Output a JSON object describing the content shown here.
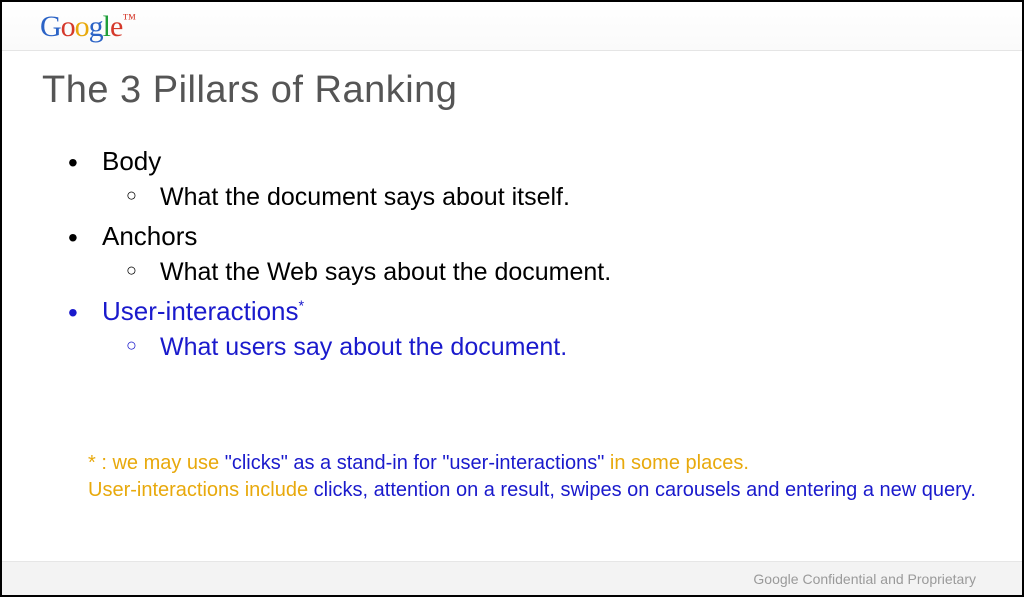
{
  "logo": {
    "g1": "G",
    "o1": "o",
    "o2": "o",
    "g2": "g",
    "l": "l",
    "e": "e",
    "tm": "™"
  },
  "title": "The 3 Pillars of Ranking",
  "pillars": [
    {
      "name": "Body",
      "desc": "What the document says about itself.",
      "highlighted": false
    },
    {
      "name": "Anchors",
      "desc": "What the Web says about the document.",
      "highlighted": false
    },
    {
      "name": "User-interactions",
      "desc": "What users say about the document.",
      "highlighted": true,
      "sup": "*"
    }
  ],
  "footnote": {
    "p1a": "* : we may use ",
    "p1b": "\"clicks\" as a stand-in for \"user-interactions\"",
    "p1c": " in some places.",
    "p2a": "User-interactions include",
    "p2b": " clicks, attention on a result, swipes on carousels and entering a new query."
  },
  "footer": "Google Confidential and Proprietary"
}
